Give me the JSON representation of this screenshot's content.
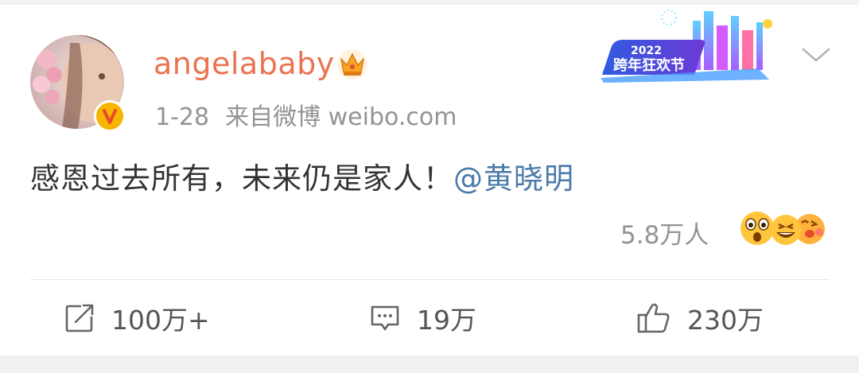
{
  "post": {
    "author": {
      "name": "angelababy",
      "verified": true,
      "badge_icon": "crown-icon",
      "verified_icon": "verified-v-icon"
    },
    "meta": {
      "date": "1-28",
      "source": "来自微博 weibo.com"
    },
    "banner": {
      "year": "2022",
      "title": "跨年狂欢节"
    },
    "content": {
      "text": "感恩过去所有，未来仍是家人！",
      "mention": "@黄晓明"
    },
    "reactions": {
      "count": "5.8万人",
      "emoji_icons": [
        "surprised-emoji-icon",
        "laughing-emoji-icon",
        "kiss-emoji-icon"
      ]
    },
    "actions": {
      "repost": "100万+",
      "comment": "19万",
      "like": "230万"
    }
  },
  "colors": {
    "username": "#eb7350",
    "mention": "#4a7aa8",
    "meta": "#939393",
    "text": "#333333",
    "badge": "#f7b500"
  }
}
